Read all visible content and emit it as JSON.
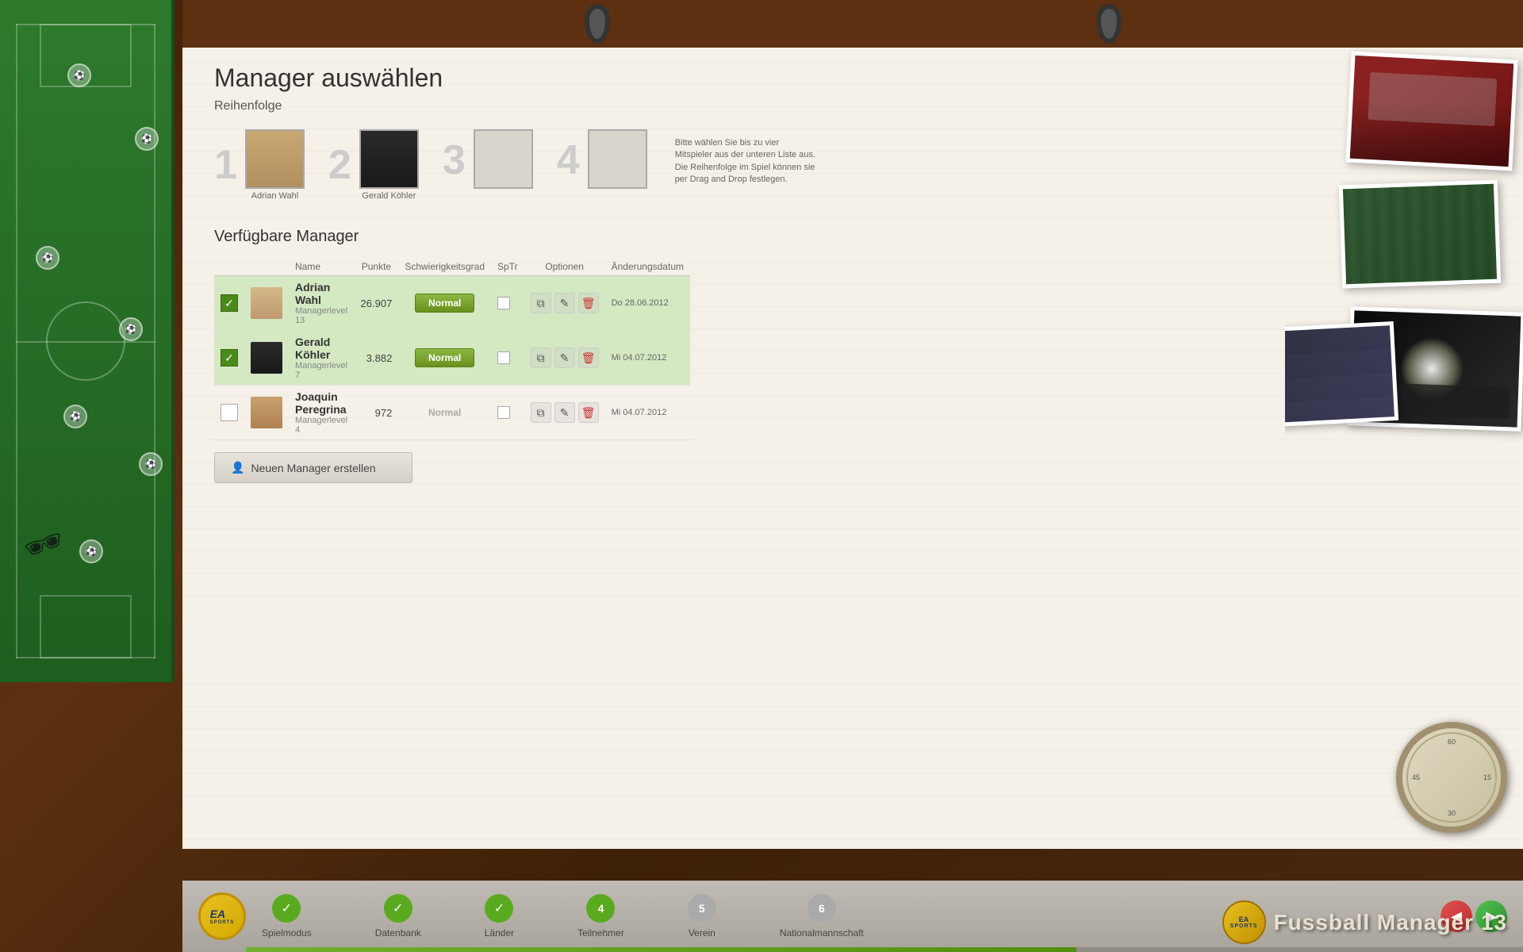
{
  "app": {
    "title": "Fussball Manager 13",
    "brand": "EA SPORTS"
  },
  "page": {
    "title": "Manager auswählen",
    "subtitle": "Reihenfolge",
    "info_text": "Bitte wählen Sie bis zu vier Mitspieler aus der unteren Liste aus. Die Reihenfolge im Spiel können sie per Drag and Drop festlegen."
  },
  "slots": [
    {
      "number": "1",
      "name": "Adrian Wahl",
      "filled": true
    },
    {
      "number": "2",
      "name": "Gerald Köhler",
      "filled": true
    },
    {
      "number": "3",
      "name": "",
      "filled": false
    },
    {
      "number": "4",
      "name": "",
      "filled": false
    }
  ],
  "table": {
    "headers": {
      "name": "Name",
      "punkte": "Punkte",
      "schwierigkeit": "Schwierigkeitsgrad",
      "sptr": "SpTr",
      "optionen": "Optionen",
      "datum": "Änderungsdatum"
    },
    "managers": [
      {
        "id": 1,
        "selected": true,
        "name": "Adrian Wahl",
        "level": "Managerlevel 13",
        "punkte": "26.907",
        "difficulty": "Normal",
        "sptr": false,
        "datum": "Do 28.06.2012"
      },
      {
        "id": 2,
        "selected": true,
        "name": "Gerald Köhler",
        "level": "Managerlevel 7",
        "punkte": "3.882",
        "difficulty": "Normal",
        "sptr": false,
        "datum": "Mi 04.07.2012"
      },
      {
        "id": 3,
        "selected": false,
        "name": "Joaquin Peregrina",
        "level": "Managerlevel 4",
        "punkte": "972",
        "difficulty": "Normal",
        "sptr": false,
        "datum": "Mi 04.07.2012"
      }
    ]
  },
  "buttons": {
    "create_manager": "Neuen Manager erstellen"
  },
  "navigation": {
    "steps": [
      {
        "number": "✓",
        "label": "Spielmodus",
        "state": "done"
      },
      {
        "number": "✓",
        "label": "Datenbank",
        "state": "done"
      },
      {
        "number": "✓",
        "label": "Länder",
        "state": "done"
      },
      {
        "number": "4",
        "label": "Teilnehmer",
        "state": "current"
      },
      {
        "number": "5",
        "label": "Verein",
        "state": "inactive"
      },
      {
        "number": "6",
        "label": "Nationalmannschaft",
        "state": "inactive"
      }
    ],
    "back": "◀",
    "forward": "▶"
  }
}
